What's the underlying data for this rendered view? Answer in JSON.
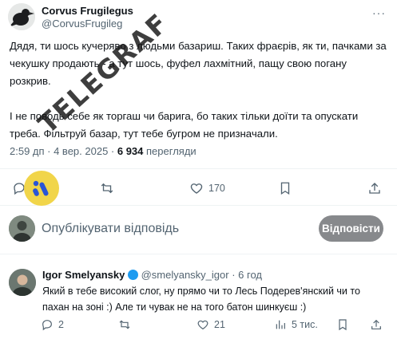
{
  "post": {
    "author_name": "Corvus Frugilegus",
    "author_handle": "@CorvusFrugileg",
    "more_label": "···",
    "paragraph1": "Дядя, ти шось кучерявo з людьми базариш. Таких фраєрів, як ти, пачками за чекушку продають - а тут шось, фуфел лахмітний, пащу свою погану розкрив.",
    "paragraph2": "І не поводь себе як торгаш чи барига, бо таких тільки доїти та опускати треба. Фільтруй базар, тут тебе бугром не призначали.",
    "time": "2:59 дп · 4 вер. 2025 · ",
    "views_count": "6 934",
    "views_label": " перегляди",
    "likes": "170"
  },
  "compose": {
    "placeholder": "Опублікувати відповідь",
    "reply_button": "Відповісти"
  },
  "reply": {
    "author_name": "Igor Smelyansky",
    "author_handle": "@smelyansky_igor",
    "time": " · 6 год",
    "text": "Який в тебе високий слог, ну прямо чи то Лесь Подерев'янский чи то пахан на зоні :) Але ти чувак не на того батон шинкуєш :)",
    "replies": "2",
    "likes": "21",
    "views": "5 тис."
  },
  "watermark": {
    "text": "TELEGRAF",
    "logo_color": "#f1d54a"
  },
  "colors": {
    "text": "#0f1419",
    "secondary": "#536471",
    "divider": "#eff3f4",
    "button": "#87898c"
  },
  "icons": [
    "reply-icon",
    "retweet-icon",
    "like-icon",
    "bookmark-icon",
    "share-icon",
    "views-icon",
    "more-icon"
  ]
}
